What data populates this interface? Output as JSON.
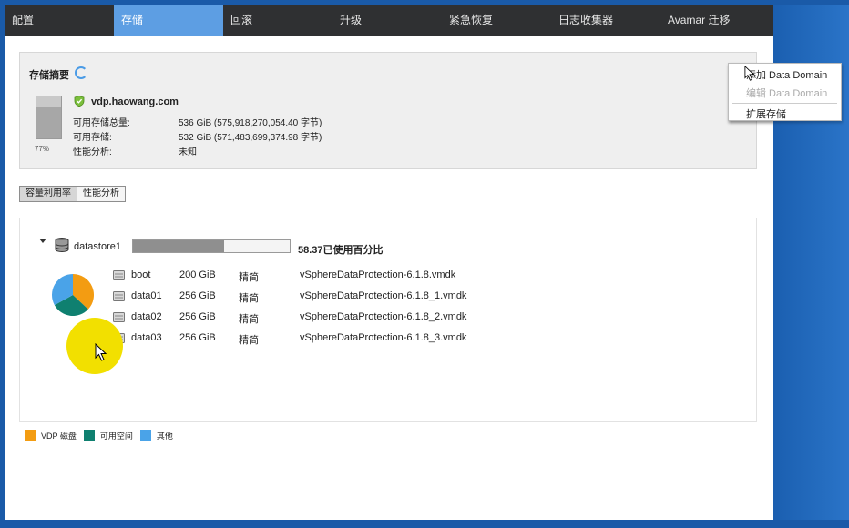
{
  "tabs": [
    {
      "label": "配置",
      "active": false
    },
    {
      "label": "存储",
      "active": true
    },
    {
      "label": "回滚",
      "active": false
    },
    {
      "label": "升级",
      "active": false
    },
    {
      "label": "紧急恢复",
      "active": false
    },
    {
      "label": "日志收集器",
      "active": false
    },
    {
      "label": "Avamar 迁移",
      "active": false
    }
  ],
  "summary": {
    "title": "存储摘要",
    "host": "vdp.haowang.com",
    "gauge_percent": 0.77,
    "gauge_label": "77%",
    "properties": [
      {
        "label": "可用存储总量:",
        "value": "536 GiB (575,918,270,054.40 字节)"
      },
      {
        "label": "可用存储:",
        "value": "532 GiB (571,483,699,374.98 字节)"
      },
      {
        "label": "性能分析:",
        "value": "未知"
      }
    ]
  },
  "context_menu": {
    "items": [
      {
        "label": "添加 Data Domain",
        "enabled": true
      },
      {
        "label": "编辑 Data Domain",
        "enabled": false
      },
      {
        "label": "扩展存储",
        "enabled": true
      }
    ]
  },
  "view_buttons": [
    {
      "label": "容量利用率",
      "active": true
    },
    {
      "label": "性能分析",
      "active": false
    }
  ],
  "datastore": {
    "name": "datastore1",
    "used_fraction": 0.5837,
    "usage_label": "58.37已使用百分比",
    "pie": [
      {
        "key": "vdp",
        "value": 0.37
      },
      {
        "key": "free",
        "value": 0.3
      },
      {
        "key": "other",
        "value": 0.33
      }
    ],
    "disks": [
      {
        "name": "boot",
        "size": "200 GiB",
        "type": "精简",
        "file": "vSphereDataProtection-6.1.8.vmdk"
      },
      {
        "name": "data01",
        "size": "256 GiB",
        "type": "精简",
        "file": "vSphereDataProtection-6.1.8_1.vmdk"
      },
      {
        "name": "data02",
        "size": "256 GiB",
        "type": "精简",
        "file": "vSphereDataProtection-6.1.8_2.vmdk"
      },
      {
        "name": "data03",
        "size": "256 GiB",
        "type": "精简",
        "file": "vSphereDataProtection-6.1.8_3.vmdk"
      }
    ]
  },
  "legend": [
    {
      "label": "VDP 磁盘",
      "color": "#f39c12"
    },
    {
      "label": "可用空间",
      "color": "#0f8070"
    },
    {
      "label": "其他",
      "color": "#4aa3e8"
    }
  ],
  "colors": {
    "tab_bar": "#2f3032",
    "tab_active": "#5d9ee3",
    "desktop": "#1a5aa8",
    "highlight": "#f2e000"
  }
}
